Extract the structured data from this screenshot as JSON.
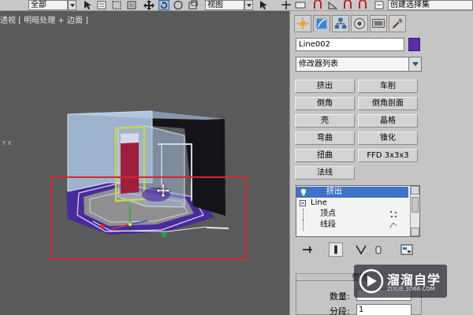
{
  "toolbar": {
    "selection_filter": "全部",
    "reference_coord": "视图",
    "named_selection": "创建选择集"
  },
  "viewport": {
    "label": "透视 [ 明暗处理 + 边面 ]",
    "axis_label": "Y X"
  },
  "command_panel": {
    "object_name": "Line002",
    "object_color": "#5e2aa8",
    "modifier_list": "修改器列表",
    "modifier_buttons": [
      "挤出",
      "车削",
      "倒角",
      "倒角剖面",
      "壳",
      "晶格",
      "弯曲",
      "锥化",
      "扭曲",
      "FFD 3x3x3",
      "法线"
    ],
    "stack": [
      {
        "label": "挤出",
        "selected": true
      },
      {
        "label": "Line",
        "selected": false
      },
      {
        "label": "顶点",
        "selected": false
      },
      {
        "label": "线段",
        "selected": false
      }
    ],
    "rollout_title": "参数",
    "fields": [
      {
        "label": "数量:",
        "value": ""
      },
      {
        "label": "分段:",
        "value": "1"
      }
    ]
  },
  "watermark": {
    "title": "溜溜自学",
    "url": "ZIXUE.3D66.COM"
  }
}
